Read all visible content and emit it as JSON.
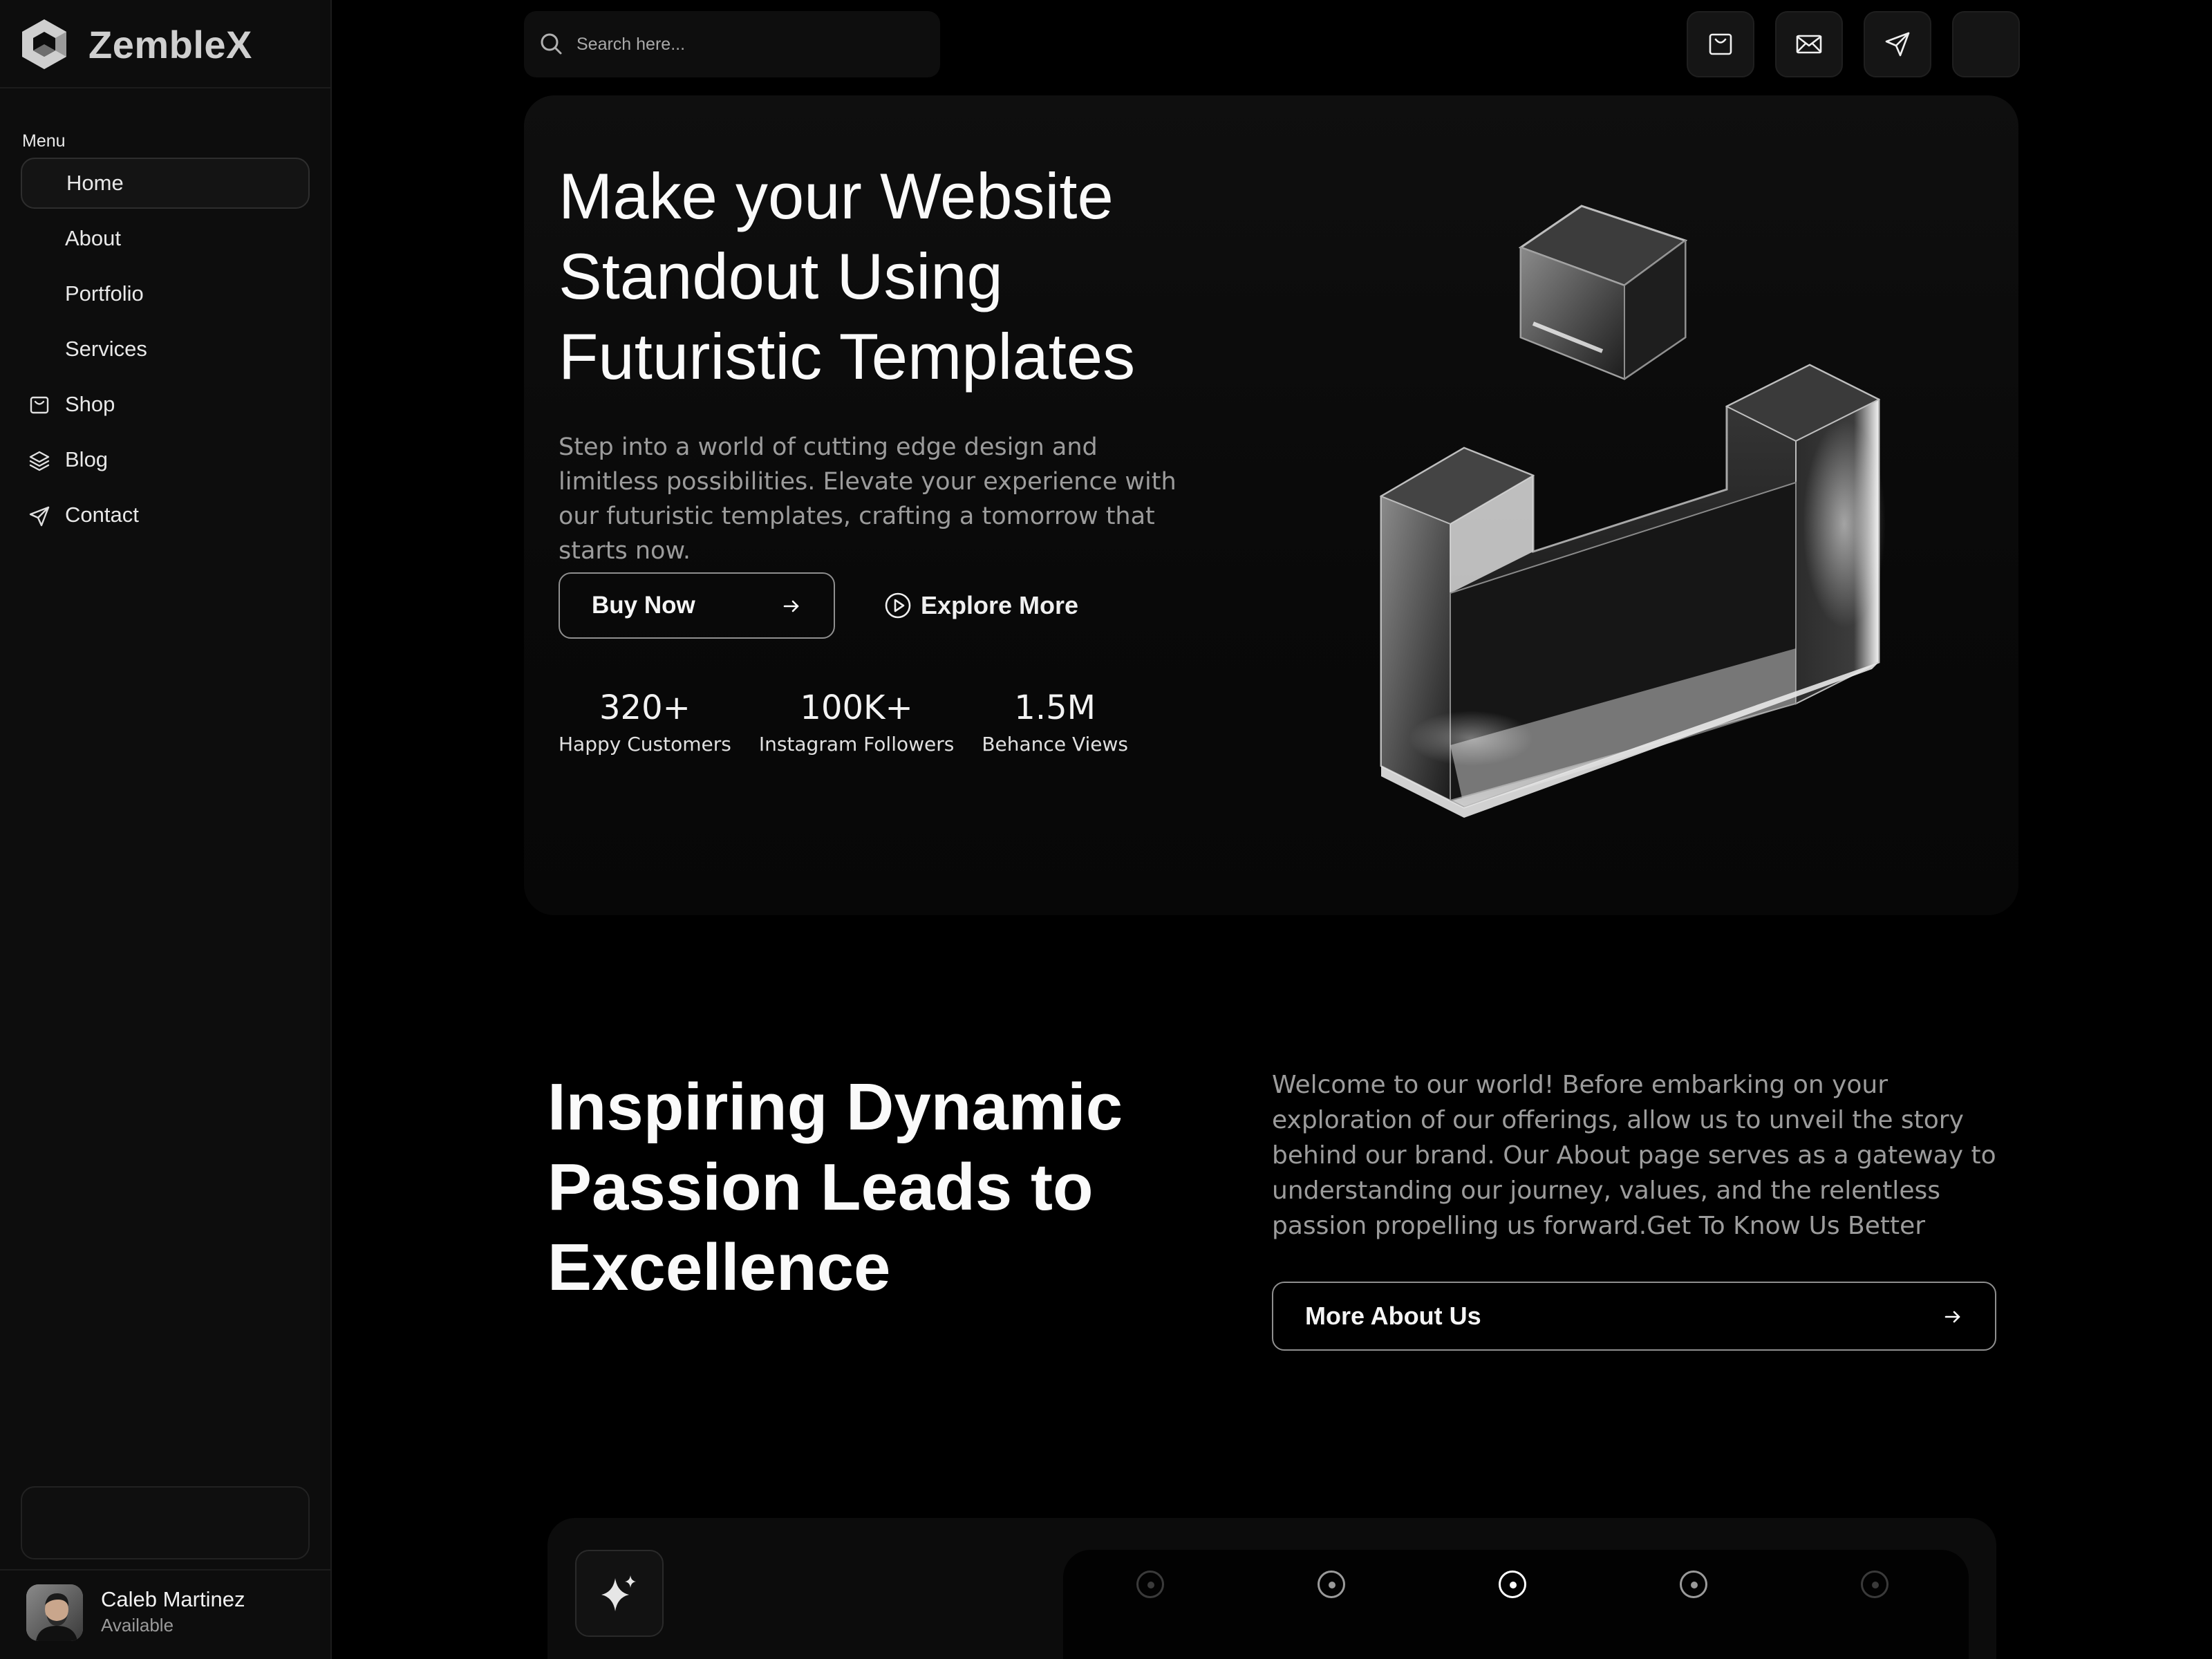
{
  "brand": {
    "name": "ZembleX"
  },
  "sidebar": {
    "menu_label": "Menu",
    "items": [
      {
        "label": "Home",
        "icon": "",
        "active": true
      },
      {
        "label": "About",
        "icon": ""
      },
      {
        "label": "Portfolio",
        "icon": ""
      },
      {
        "label": "Services",
        "icon": ""
      },
      {
        "label": "Shop",
        "icon": "shopping-bag-icon"
      },
      {
        "label": "Blog",
        "icon": "layers-icon"
      },
      {
        "label": "Contact",
        "icon": "send-icon"
      }
    ],
    "user": {
      "name": "Caleb Martinez",
      "status": "Available"
    }
  },
  "topbar": {
    "search_placeholder": "Search here...",
    "icons": [
      "shopping-bag-icon",
      "mail-icon",
      "send-icon",
      "blank-button"
    ]
  },
  "hero": {
    "title": "Make your Website Standout Using Futuristic  Templates",
    "subtitle": "Step into a world of cutting edge design and limitless possibilities. Elevate your experience with our futuristic templates, crafting a tomorrow that starts now.",
    "buy_label": "Buy Now",
    "explore_label": "Explore More",
    "stats": [
      {
        "value": "320+",
        "label": "Happy Customers"
      },
      {
        "value": "100K+",
        "label": "Instagram Followers"
      },
      {
        "value": "1.5M",
        "label": "Behance Views"
      }
    ]
  },
  "about": {
    "title": "Inspiring Dynamic Passion Leads to Excellence",
    "text": "Welcome to our world! Before embarking on your exploration of our offerings, allow us to unveil the story behind our brand. Our About page serves as a gateway to understanding our journey, values, and the relentless passion propelling us forward.Get To Know Us Better",
    "button_label": "More About Us"
  },
  "colors": {
    "background": "#000000",
    "sidebar": "#0d0d0d",
    "accent": "#ffffff",
    "muted_text": "#9c9c9c"
  }
}
